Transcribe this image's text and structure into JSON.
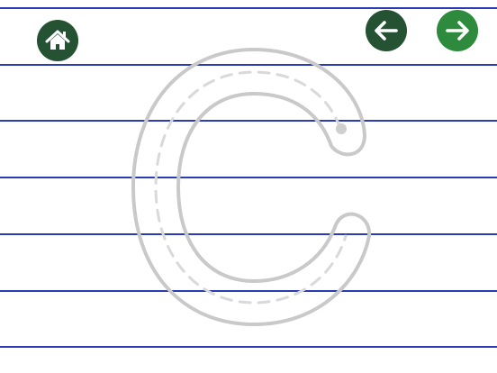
{
  "worksheet": {
    "letter": "C",
    "colors": {
      "ruled_line": "#2b3bb5",
      "letter_outline": "#c9c9c9",
      "letter_guide": "#d6d6d6",
      "background": "#ffffff"
    }
  },
  "nav": {
    "home": {
      "icon": "home-icon",
      "color": "#255232"
    },
    "prev": {
      "icon": "arrow-left-icon",
      "color": "#255232"
    },
    "next": {
      "icon": "arrow-right-icon",
      "color": "#2e8b3e"
    }
  }
}
